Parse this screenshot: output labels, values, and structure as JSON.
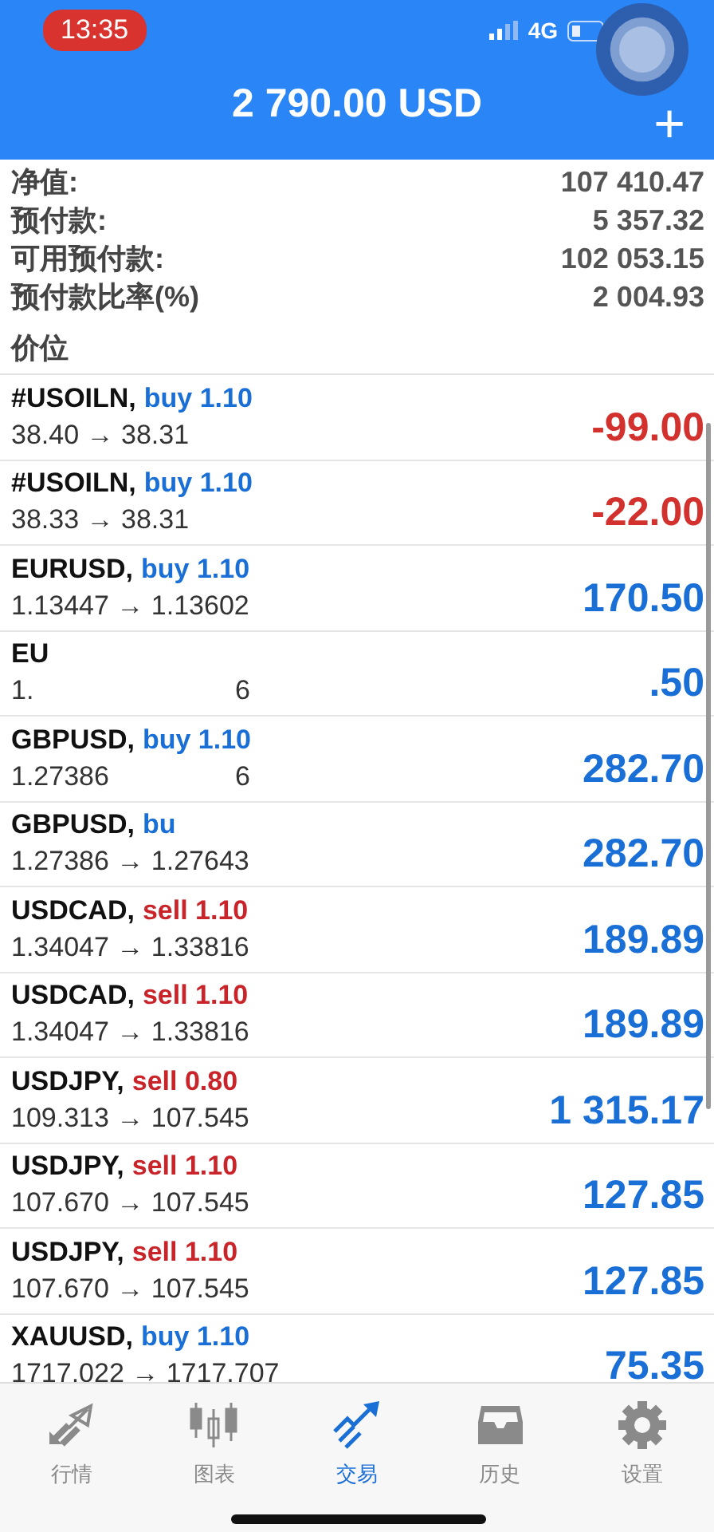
{
  "status_bar": {
    "time": "13:35",
    "network": "4G"
  },
  "header": {
    "title": "2 790.00 USD",
    "add_label": "+"
  },
  "summary": [
    {
      "label": "净值:",
      "value": "107 410.47"
    },
    {
      "label": "预付款:",
      "value": "5 357.32"
    },
    {
      "label": "可用预付款:",
      "value": "102 053.15"
    },
    {
      "label": "预付款比率(%)",
      "value": "2 004.93"
    }
  ],
  "section_title": "价位",
  "positions": [
    {
      "symbol": "#USOILN,",
      "deal": {
        "text": "buy 1.10",
        "color": "#1a6fd6"
      },
      "prices": "38.40 → 38.31",
      "profit": {
        "text": "-99.00",
        "color": "#d2312e"
      }
    },
    {
      "symbol": "#USOILN,",
      "deal": {
        "text": "buy 1.10",
        "color": "#1a6fd6"
      },
      "prices": "38.33 → 38.31",
      "profit": {
        "text": "-22.00",
        "color": "#d2312e"
      }
    },
    {
      "symbol": "EURUSD,",
      "deal": {
        "text": "buy 1.10",
        "color": "#1a6fd6"
      },
      "prices": "1.13447 → 1.13602",
      "profit": {
        "text": "170.50",
        "color": "#1a6fd6"
      }
    },
    {
      "symbol": "EU",
      "prices": "1.",
      "prices_tail": "6",
      "profit": {
        "text": ".50",
        "color": "#1a6fd6"
      }
    },
    {
      "symbol": "GBPUSD,",
      "deal": {
        "text": "buy 1.10",
        "color": "#1a6fd6"
      },
      "prices": "1.27386",
      "prices_tail": "6",
      "profit": {
        "text": "282.70",
        "color": "#1a6fd6"
      }
    },
    {
      "symbol": "GBPUSD,",
      "deal": {
        "text": "bu",
        "color": "#1a6fd6"
      },
      "prices": "1.27386 → 1.27643",
      "profit": {
        "text": "282.70",
        "color": "#1a6fd6"
      }
    },
    {
      "symbol": "USDCAD,",
      "deal": {
        "text": "sell 1.10",
        "color": "#c8242a"
      },
      "prices": "1.34047 → 1.33816",
      "profit": {
        "text": "189.89",
        "color": "#1a6fd6"
      }
    },
    {
      "symbol": "USDCAD,",
      "deal": {
        "text": "sell 1.10",
        "color": "#c8242a"
      },
      "prices": "1.34047 → 1.33816",
      "profit": {
        "text": "189.89",
        "color": "#1a6fd6"
      }
    },
    {
      "symbol": "USDJPY,",
      "deal": {
        "text": "sell 0.80",
        "color": "#c8242a"
      },
      "prices": "109.313 → 107.545",
      "profit": {
        "text": "1 315.17",
        "color": "#1a6fd6"
      }
    },
    {
      "symbol": "USDJPY,",
      "deal": {
        "text": "sell 1.10",
        "color": "#c8242a"
      },
      "prices": "107.670 → 107.545",
      "profit": {
        "text": "127.85",
        "color": "#1a6fd6"
      }
    },
    {
      "symbol": "USDJPY,",
      "deal": {
        "text": "sell 1.10",
        "color": "#c8242a"
      },
      "prices": "107.670 → 107.545",
      "profit": {
        "text": "127.85",
        "color": "#1a6fd6"
      }
    },
    {
      "symbol": "XAUUSD,",
      "deal": {
        "text": "buy 1.10",
        "color": "#1a6fd6"
      },
      "prices": "1717.022 → 1717.707",
      "profit": {
        "text": "75.35",
        "color": "#1a6fd6"
      }
    }
  ],
  "tabs": [
    {
      "label": "行情",
      "selected": false
    },
    {
      "label": "图表",
      "selected": false
    },
    {
      "label": "交易",
      "selected": true
    },
    {
      "label": "历史",
      "selected": false
    },
    {
      "label": "设置",
      "selected": false
    }
  ]
}
